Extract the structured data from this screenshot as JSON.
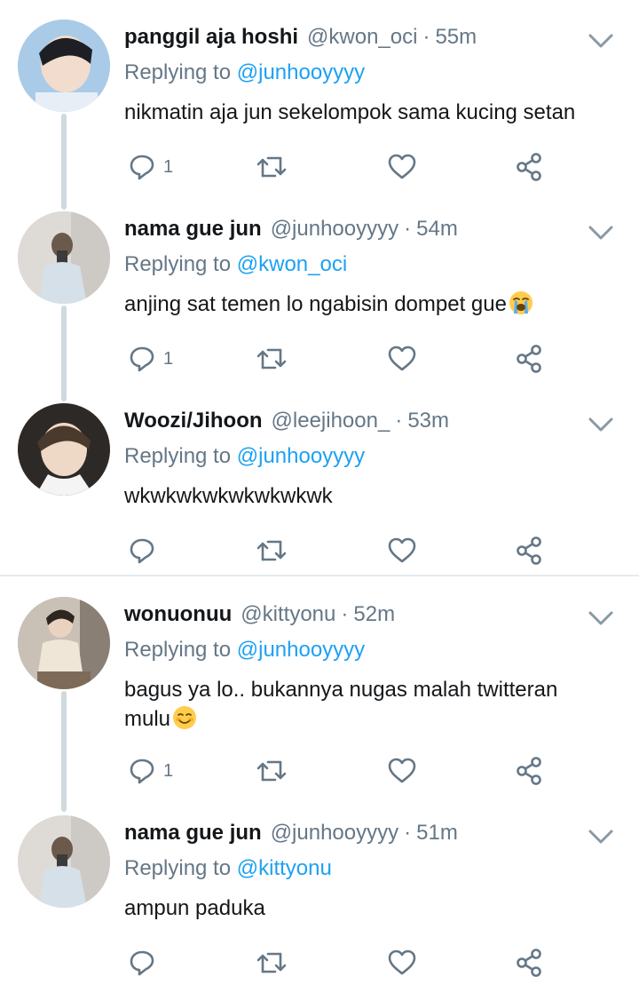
{
  "tweets": [
    {
      "name": "panggil aja hoshi",
      "handle": "@kwon_oci",
      "time": "55m",
      "replying_prefix": "Replying to",
      "replying_to": "@junhooyyyy",
      "text": "nikmatin aja jun sekelompok sama kucing setan",
      "reply_count": "1",
      "avatar_color": "#9bbfe0",
      "icons": [
        "reply-icon",
        "retweet-icon",
        "like-icon",
        "share-icon",
        "chevron-down-icon"
      ]
    },
    {
      "name": "nama gue jun",
      "handle": "@junhooyyyy",
      "time": "54m",
      "replying_prefix": "Replying to",
      "replying_to": "@kwon_oci",
      "text": "anjing sat temen lo ngabisin dompet gue",
      "emoji": "loudly-crying-face-emoji",
      "reply_count": "1",
      "avatar_color": "#d9d6d2"
    },
    {
      "name": "Woozi/Jihoon",
      "handle": "@leejihoon_",
      "time": "53m",
      "replying_prefix": "Replying to",
      "replying_to": "@junhooyyyy",
      "text": "wkwkwkwkwkwkwkwk",
      "reply_count": "",
      "avatar_color": "#3a3530"
    },
    {
      "name": "wonuonuu",
      "handle": "@kittyonu",
      "time": "52m",
      "replying_prefix": "Replying to",
      "replying_to": "@junhooyyyy",
      "text_line1": "bagus ya lo.. bukannya nugas malah twitteran",
      "text_line2": "mulu",
      "emoji": "smiling-face-emoji",
      "reply_count": "1",
      "avatar_color": "#b9a99a"
    },
    {
      "name": "nama gue jun",
      "handle": "@junhooyyyy",
      "time": "51m",
      "replying_prefix": "Replying to",
      "replying_to": "@kittyonu",
      "text": "ampun paduka",
      "reply_count": "",
      "avatar_color": "#d9d6d2"
    }
  ],
  "colors": {
    "link": "#1da1f2",
    "secondary_text": "#657786",
    "thread_line": "#cfd9de",
    "divider": "#e6ecf0"
  }
}
